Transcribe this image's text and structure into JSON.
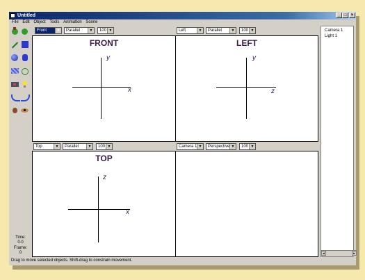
{
  "window": {
    "title": "Untitled",
    "min": "_",
    "max": "□",
    "close": "×"
  },
  "menu": [
    "File",
    "Edit",
    "Object",
    "Tools",
    "Animation",
    "Scene"
  ],
  "viewports": {
    "front": {
      "title": "FRONT",
      "view": "Front",
      "projection": "Parallel",
      "zoom": "100",
      "axis_x": "x",
      "axis_y": "y"
    },
    "left": {
      "title": "LEFT",
      "view": "Left",
      "projection": "Parallel",
      "zoom": "100",
      "axis_x": "z",
      "axis_y": "y"
    },
    "top": {
      "title": "TOP",
      "view": "Top",
      "projection": "Parallel",
      "zoom": "100",
      "axis_x": "x",
      "axis_y": "z"
    },
    "camera": {
      "view": "Camera 1",
      "projection": "Perspective",
      "zoom": "100"
    }
  },
  "scene_objects": [
    "Camera 1",
    "Light 1"
  ],
  "scroll": {
    "left": "◂",
    "right": "▸"
  },
  "time": {
    "time_label": "Time:",
    "time_value": "0.0",
    "frame_label": "Frame:",
    "frame_value": "0"
  },
  "status": "Drag to move selected objects.  Shift-drag to constrain movement.",
  "tools": [
    "move-tool-icon",
    "rotate-tool-icon",
    "pencil-tool-icon",
    "cube-tool-icon",
    "sphere-tool-icon",
    "cylinder-tool-icon",
    "tube-tool-icon",
    "polygon-tool-icon",
    "camera-tool-icon",
    "light-tool-icon",
    "spline-tool-icon",
    "curve-tool-icon",
    "pan-tool-icon",
    "eye-tool-icon"
  ],
  "colors": {
    "accent": "#0a246a",
    "desktop": "#f7e9ad",
    "label": "#3a1a4a"
  }
}
